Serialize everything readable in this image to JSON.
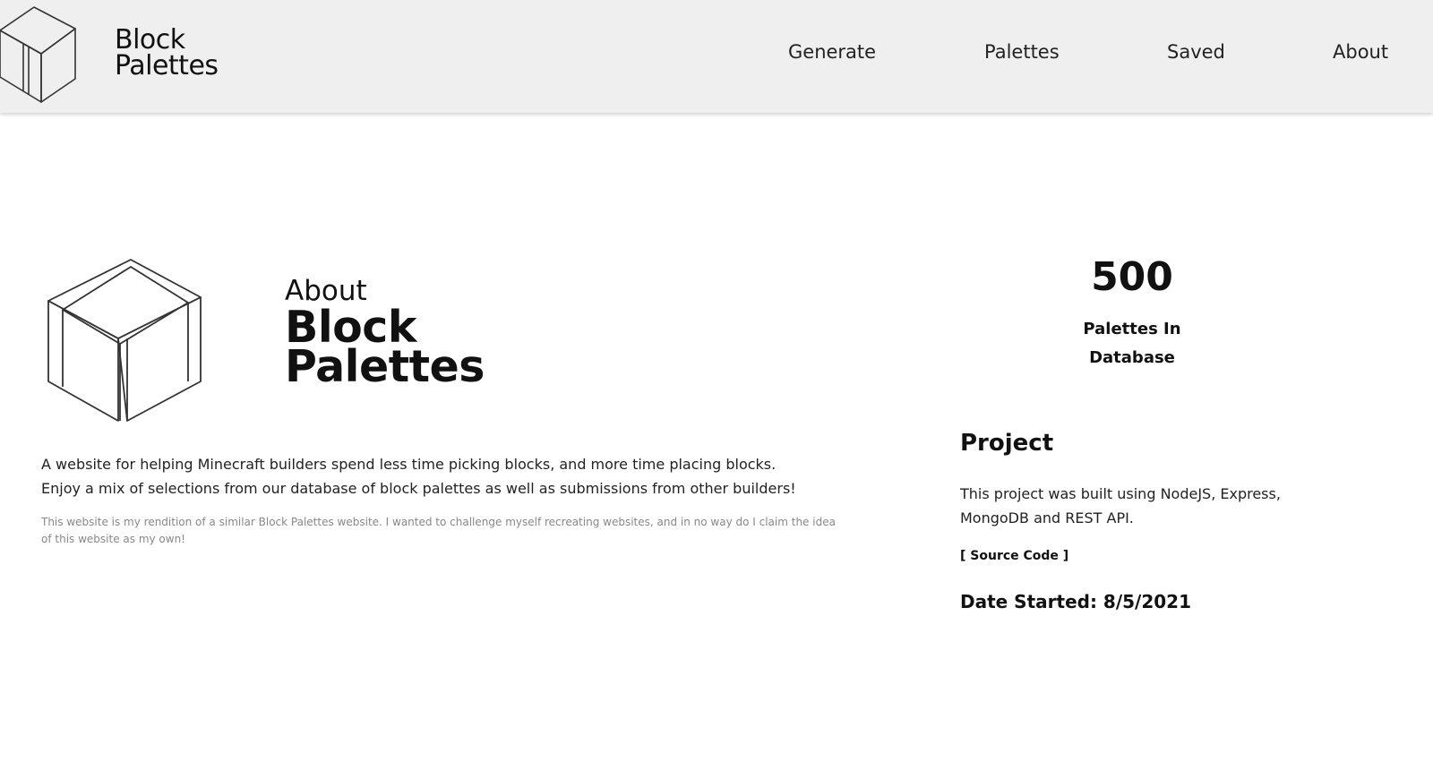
{
  "header": {
    "brand_line1": "Block",
    "brand_line2": "Palettes",
    "logo_icon": "cube-outline-icon",
    "nav": {
      "generate": "Generate",
      "palettes": "Palettes",
      "saved": "Saved",
      "about": "About"
    },
    "background": "#efefef"
  },
  "hero": {
    "logo_icon": "cube-outline-icon",
    "title_small": "About",
    "title_line1": "Block",
    "title_line2": "Palettes"
  },
  "description": {
    "line1": "A website for helping Minecraft builders spend less time picking blocks, and more time placing blocks.",
    "line2": "Enjoy a mix of selections from our database of block palettes as well as submissions from other builders!",
    "disclaimer": "This website is my rendition of a similar Block Palettes website. I wanted to challenge myself recreating websites, and in no way do I claim the idea of this website as my own!"
  },
  "stats": {
    "count": "500",
    "label_line1": "Palettes In",
    "label_line2": "Database"
  },
  "project": {
    "heading": "Project",
    "description": "This project was built using NodeJS, Express, MongoDB and REST API.",
    "source_link": "[ Source Code ]",
    "date_started": "Date Started: 8/5/2021"
  }
}
